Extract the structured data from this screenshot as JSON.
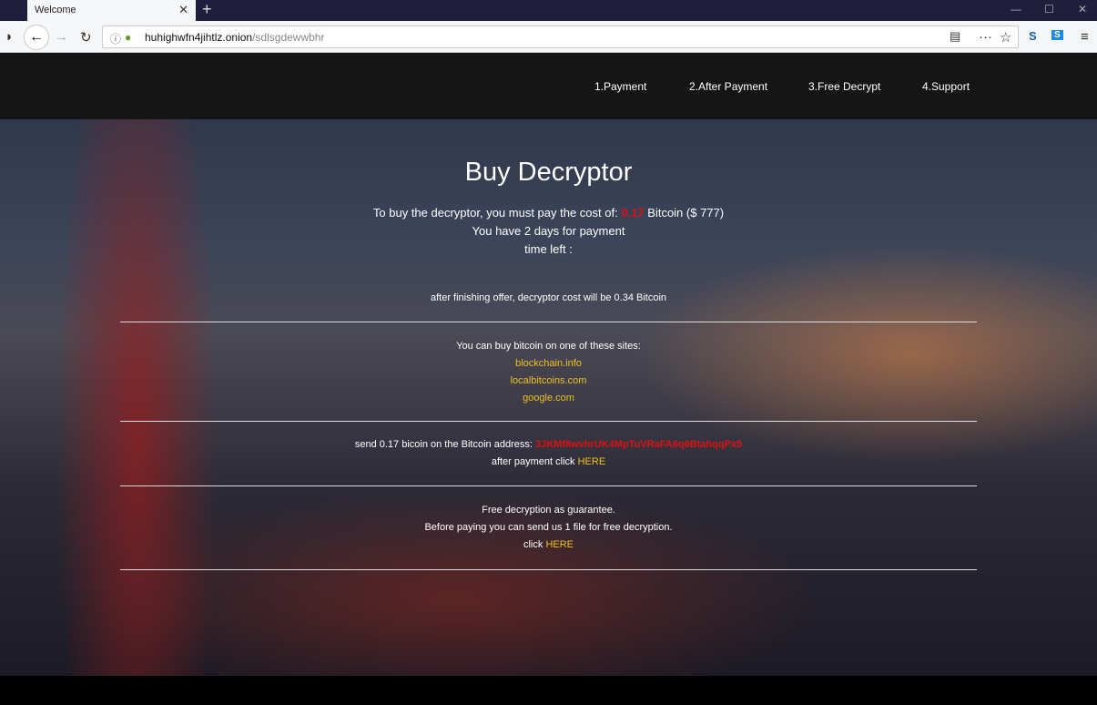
{
  "browser": {
    "tab_title": "Welcome",
    "url_host": "huhighwfn4jihtlz.onion",
    "url_path": "/sdlsgdewwbhr"
  },
  "nav": [
    "1.Payment",
    "2.After Payment",
    "3.Free Decrypt",
    "4.Support"
  ],
  "title": "Buy Decryptor",
  "cost": {
    "prefix": "To buy the decryptor, you must pay the cost of: ",
    "amount": "0.17",
    "suffix": " Bitcoin ($ 777)"
  },
  "days": "You have 2 days for payment",
  "time_left": "time left :",
  "offer": "after finishing offer, decryptor cost will be 0.34 Bitcoin",
  "buy": {
    "intro": "You can buy bitcoin on one of these sites:",
    "sites": [
      "blockchain.info",
      "localbitcoins.com",
      "google.com"
    ]
  },
  "send": {
    "prefix": "send 0.17 bicoin on the Bitcoin address: ",
    "address": "3JKMf8wvhrUK4MpTuVRaFA6q6BtahqqPx5",
    "after": "after payment click ",
    "here": "HERE"
  },
  "free": {
    "line1": "Free decryption as guarantee.",
    "line2": "Before paying you can send us 1 file for free decryption.",
    "click": "click ",
    "here": "HERE"
  },
  "colors": {
    "accent_red": "#e01010",
    "link_yellow": "#f0c020"
  }
}
